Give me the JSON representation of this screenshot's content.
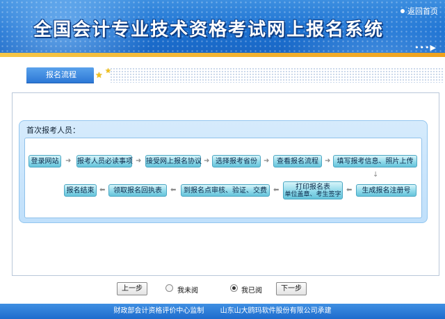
{
  "header": {
    "title": "全国会计专业技术资格考试网上报名系统",
    "back_home": "返回首页",
    "decor_arrows": "•••▶"
  },
  "tab": {
    "label": "报名流程"
  },
  "panel": {
    "heading": "首次报考人员：",
    "steps_row1": [
      "登录网站",
      "报考人员必读事项",
      "接受网上报名协议",
      "选择报考省份",
      "查看报名流程",
      "填写报考信息、照片上传"
    ],
    "steps_row2": [
      "报名结束",
      "领取报名回执表",
      "到报名点审核、验证、交费",
      "打印报名表",
      "单位盖章、考生签字",
      "生成报名注册号"
    ]
  },
  "controls": {
    "prev": "上一步",
    "not_read": "我未阅",
    "read": "我已阅",
    "next": "下一步",
    "selected": "read"
  },
  "footer": {
    "supervisor": "财政部会计资格评价中心监制",
    "contractor": "山东山大鸥玛软件股份有限公司承建"
  }
}
